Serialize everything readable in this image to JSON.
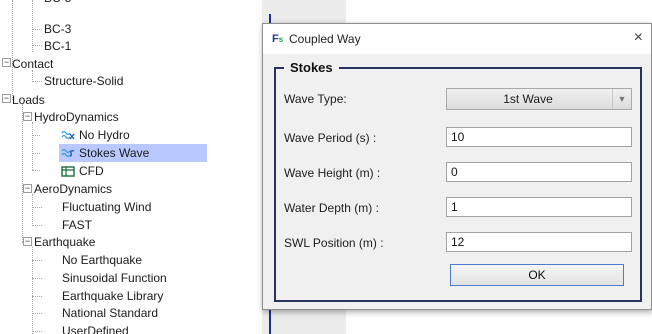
{
  "tree": {
    "items": [
      {
        "label": "BC-3"
      },
      {
        "label": "BC-1"
      },
      {
        "label": "Contact"
      },
      {
        "label": "Structure-Solid"
      },
      {
        "label": "Loads"
      },
      {
        "label": "HydroDynamics"
      },
      {
        "label": "No Hydro"
      },
      {
        "label": "Stokes Wave"
      },
      {
        "label": "CFD"
      },
      {
        "label": "AeroDynamics"
      },
      {
        "label": "Fluctuating Wind"
      },
      {
        "label": "FAST"
      },
      {
        "label": "Earthquake"
      },
      {
        "label": "No Earthquake"
      },
      {
        "label": "Sinusoidal Function"
      },
      {
        "label": "Earthquake Library"
      },
      {
        "label": "National Standard"
      },
      {
        "label": "UserDefined"
      }
    ],
    "expander_symbol": "−"
  },
  "dialog": {
    "title": "Coupled Way",
    "close_symbol": "×",
    "icon_text": "F",
    "icon_sub": "s",
    "group_title": "Stokes",
    "wave_type_label": "Wave Type:",
    "wave_type_value": "1st Wave",
    "wave_period_label": "Wave Period (s) :",
    "wave_period_value": "10",
    "wave_height_label": "Wave Height (m) :",
    "wave_height_value": "0",
    "water_depth_label": "Water Depth (m) :",
    "water_depth_value": "1",
    "swl_position_label": "SWL Position (m) :",
    "swl_position_value": "12",
    "ok_label": "OK"
  },
  "colors": {
    "selection": "#b9c9ff",
    "group_border": "#25335f",
    "accent_line": "#1d2f8f"
  }
}
